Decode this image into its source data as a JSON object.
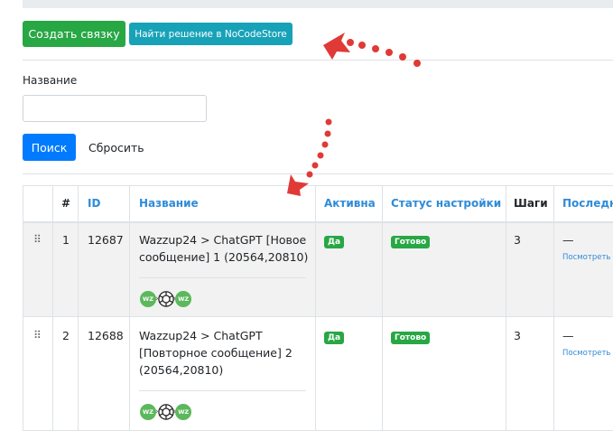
{
  "toolbar": {
    "create_label": "Создать связку",
    "find_label": "Найти решение в NoCodeStore"
  },
  "filter": {
    "name_label": "Название",
    "name_value": "",
    "search_label": "Поиск",
    "reset_label": "Сбросить"
  },
  "table": {
    "headers": {
      "hash": "#",
      "id": "ID",
      "name": "Название",
      "active": "Активна",
      "status": "Статус настройки",
      "steps": "Шаги",
      "last": "Последн"
    },
    "rows": [
      {
        "num": "1",
        "id": "12687",
        "name_lines": [
          "Wazzup24 > ChatGPT [Новое",
          "сообщение] 1 (20564,20810)"
        ],
        "active": "Да",
        "status": "Готово",
        "steps": "3",
        "last": "—",
        "view": "Посмотреть",
        "chain": [
          "WZ",
          "WZ"
        ]
      },
      {
        "num": "2",
        "id": "12688",
        "name_lines": [
          "Wazzup24 > ChatGPT",
          "[Повторное сообщение] 2",
          "(20564,20810)"
        ],
        "active": "Да",
        "status": "Готово",
        "steps": "3",
        "last": "—",
        "view": "Посмотреть",
        "chain": [
          "WZ",
          "WZ"
        ]
      }
    ]
  },
  "colors": {
    "green": "#28a745",
    "teal": "#17a2b8",
    "blue": "#007bff",
    "link": "#2e8bd8",
    "annotation": "#e03a36"
  }
}
